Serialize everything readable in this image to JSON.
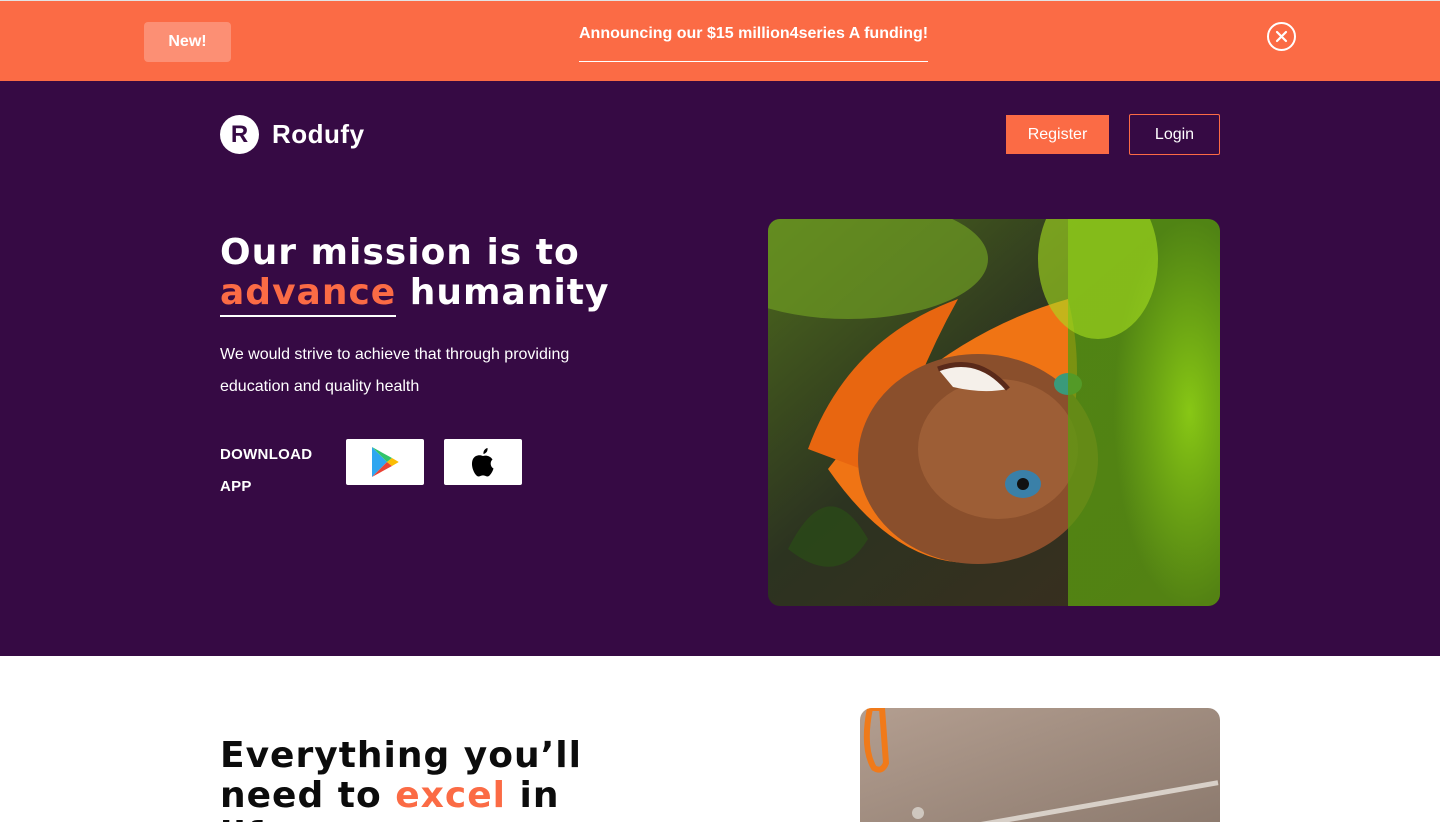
{
  "announcement": {
    "badge": "New!",
    "text": "Announcing our $15 million4series A funding!",
    "close_icon": "close-circle-icon"
  },
  "header": {
    "logo_mark": "R",
    "logo_text": "Rodufy",
    "register_label": "Register",
    "login_label": "Login"
  },
  "hero": {
    "title_line1": "Our mission is to",
    "title_accent": "advance",
    "title_rest": " humanity",
    "subtitle": "We would strive to achieve that through providing education and quality health",
    "download_label": "DOWNLOAD APP",
    "play_store_icon": "google-play-icon",
    "app_store_icon": "apple-icon"
  },
  "section2": {
    "title_line1": "Everything you’ll",
    "title_line2_a": "need to ",
    "title_accent": "excel",
    "title_line2_b": " in life"
  },
  "colors": {
    "accent": "#fb6b45",
    "hero_bg": "#360a44",
    "badge_bg": "#fc8f74",
    "white": "#ffffff"
  }
}
